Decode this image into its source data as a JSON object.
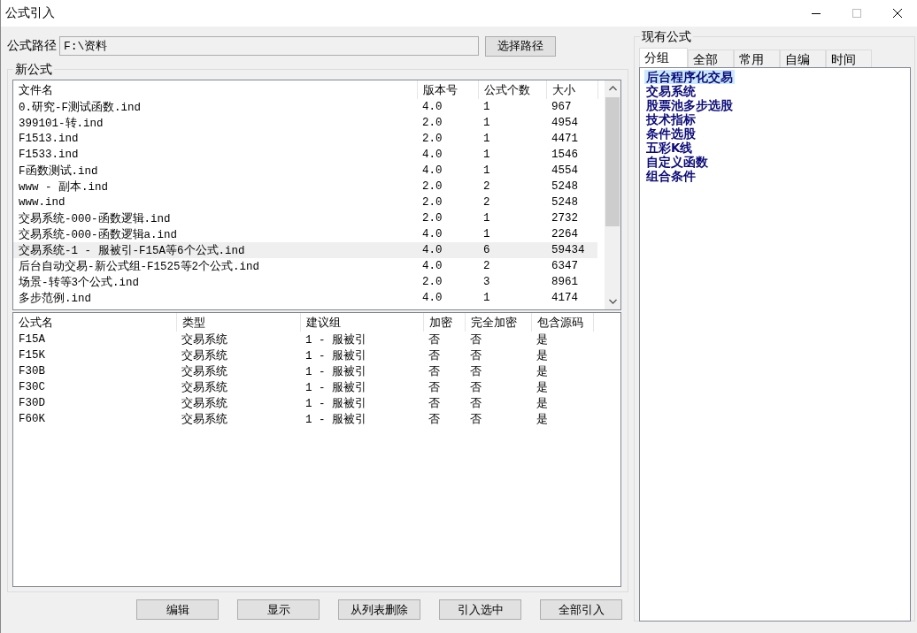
{
  "window": {
    "title": "公式引入"
  },
  "path": {
    "label": "公式路径",
    "value": "F:\\资料",
    "button": "选择路径"
  },
  "new_formulas": {
    "title": "新公式",
    "files": {
      "columns": [
        "文件名",
        "版本号",
        "公式个数",
        "大小"
      ],
      "rows": [
        {
          "cells": [
            "0.研究-F测试函数.ind",
            "4.0",
            "1",
            "967"
          ],
          "selected": false
        },
        {
          "cells": [
            "399101-转.ind",
            "2.0",
            "1",
            "4954"
          ],
          "selected": false
        },
        {
          "cells": [
            "F1513.ind",
            "2.0",
            "1",
            "4471"
          ],
          "selected": false
        },
        {
          "cells": [
            "F1533.ind",
            "4.0",
            "1",
            "1546"
          ],
          "selected": false
        },
        {
          "cells": [
            "F函数测试.ind",
            "4.0",
            "1",
            "4554"
          ],
          "selected": false
        },
        {
          "cells": [
            "www - 副本.ind",
            "2.0",
            "2",
            "5248"
          ],
          "selected": false
        },
        {
          "cells": [
            "www.ind",
            "2.0",
            "2",
            "5248"
          ],
          "selected": false
        },
        {
          "cells": [
            "交易系统-000-函数逻辑.ind",
            "2.0",
            "1",
            "2732"
          ],
          "selected": false
        },
        {
          "cells": [
            "交易系统-000-函数逻辑a.ind",
            "4.0",
            "1",
            "2264"
          ],
          "selected": false
        },
        {
          "cells": [
            "交易系统-1 - 服被引-F15A等6个公式.ind",
            "4.0",
            "6",
            "59434"
          ],
          "selected": true
        },
        {
          "cells": [
            "后台自动交易-新公式组-F1525等2个公式.ind",
            "4.0",
            "2",
            "6347"
          ],
          "selected": false
        },
        {
          "cells": [
            "场景-转等3个公式.ind",
            "2.0",
            "3",
            "8961"
          ],
          "selected": false
        },
        {
          "cells": [
            "多步范例.ind",
            "4.0",
            "1",
            "4174"
          ],
          "selected": false
        }
      ]
    },
    "formulas": {
      "columns": [
        "公式名",
        "类型",
        "建议组",
        "加密",
        "完全加密",
        "包含源码"
      ],
      "rows": [
        [
          "F15A",
          "交易系统",
          "1 - 服被引",
          "否",
          "否",
          "是"
        ],
        [
          "F15K",
          "交易系统",
          "1 - 服被引",
          "否",
          "否",
          "是"
        ],
        [
          "F30B",
          "交易系统",
          "1 - 服被引",
          "否",
          "否",
          "是"
        ],
        [
          "F30C",
          "交易系统",
          "1 - 服被引",
          "否",
          "否",
          "是"
        ],
        [
          "F30D",
          "交易系统",
          "1 - 服被引",
          "否",
          "否",
          "是"
        ],
        [
          "F60K",
          "交易系统",
          "1 - 服被引",
          "否",
          "否",
          "是"
        ]
      ]
    }
  },
  "buttons": [
    "编辑",
    "显示",
    "从列表删除",
    "引入选中",
    "全部引入"
  ],
  "existing_formulas": {
    "title": "现有公式",
    "tabs": [
      {
        "label": "分组",
        "selected": true
      },
      {
        "label": "全部",
        "selected": false
      },
      {
        "label": "常用",
        "selected": false
      },
      {
        "label": "自编",
        "selected": false
      },
      {
        "label": "时间",
        "selected": false
      }
    ],
    "groups": [
      {
        "label": "后台程序化交易",
        "selected": true
      },
      {
        "label": "交易系统",
        "selected": false
      },
      {
        "label": "股票池多步选股",
        "selected": false
      },
      {
        "label": "技术指标",
        "selected": false
      },
      {
        "label": "条件选股",
        "selected": false
      },
      {
        "label": "五彩K线",
        "selected": false
      },
      {
        "label": "自定义函数",
        "selected": false
      },
      {
        "label": "组合条件",
        "selected": false
      }
    ]
  }
}
